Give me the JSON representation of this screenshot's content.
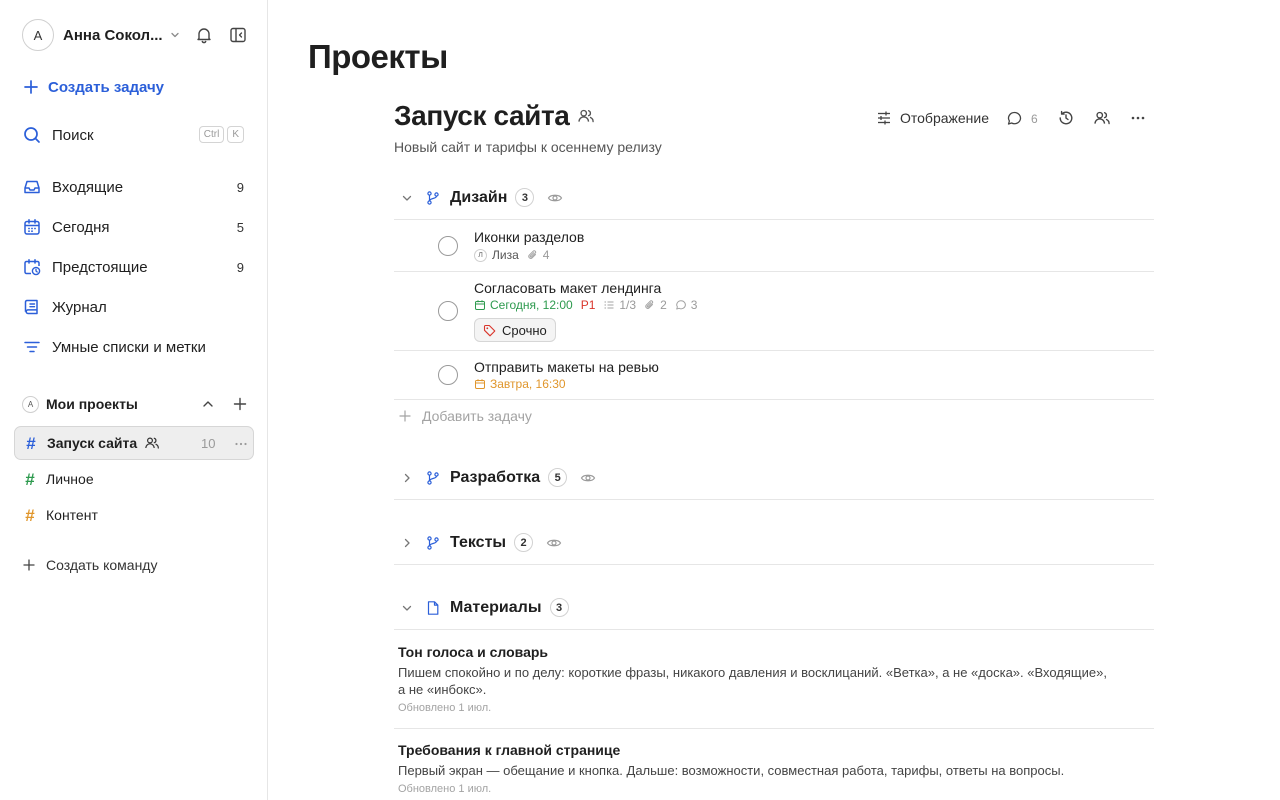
{
  "sidebar": {
    "user": {
      "initial": "А",
      "name": "Анна Сокол..."
    },
    "create_task": "Создать задачу",
    "search": {
      "label": "Поиск",
      "shortcut": [
        "Ctrl",
        "K"
      ]
    },
    "nav": [
      {
        "label": "Входящие",
        "count": "9",
        "icon": "inbox-icon"
      },
      {
        "label": "Сегодня",
        "count": "5",
        "icon": "calendar-icon"
      },
      {
        "label": "Предстоящие",
        "count": "9",
        "icon": "upcoming-icon"
      },
      {
        "label": "Журнал",
        "count": "",
        "icon": "journal-icon"
      },
      {
        "label": "Умные списки и метки",
        "count": "",
        "icon": "filter-icon"
      }
    ],
    "projects_section": {
      "initial": "А",
      "title": "Мои проекты"
    },
    "projects": [
      {
        "name": "Запуск сайта",
        "count": "10",
        "color": "#2b5fd9",
        "active": true
      },
      {
        "name": "Личное",
        "color": "#2d9a4e"
      },
      {
        "name": "Контент",
        "color": "#e0962c"
      }
    ],
    "create_team": "Создать команду"
  },
  "main": {
    "page_title": "Проекты",
    "project": {
      "title": "Запуск сайта",
      "description": "Новый сайт и тарифы к осеннему релизу"
    },
    "toolbar": {
      "display_label": "Отображение",
      "comments_count": "6"
    },
    "sections": [
      {
        "title": "Дизайн",
        "count": "3",
        "tasks": [
          {
            "title": "Иконки разделов",
            "assignee_initial": "Л",
            "assignee": "Лиза",
            "attachments": "4"
          },
          {
            "title": "Согласовать макет лендинга",
            "date": "Сегодня, 12:00",
            "priority": "P1",
            "subtasks": "1/3",
            "attachments": "2",
            "comments": "3",
            "tag": "Срочно"
          },
          {
            "title": "Отправить макеты на ревью",
            "date": "Завтра, 16:30"
          }
        ],
        "add_task": "Добавить задачу"
      },
      {
        "title": "Разработка",
        "count": "5"
      },
      {
        "title": "Тексты",
        "count": "2"
      },
      {
        "title": "Материалы",
        "count": "3",
        "docs": [
          {
            "title": "Тон голоса и словарь",
            "body": "Пишем спокойно и по делу: короткие фразы, никакого давления и восклицаний. «Ветка», а не «доска». «Входящие», а не «инбокс».",
            "updated": "Обновлено 1 июл."
          },
          {
            "title": "Требования к главной странице",
            "body": "Первый экран — обещание и кнопка. Дальше: возможности, совместная работа, тарифы, ответы на вопросы.",
            "updated": "Обновлено 1 июл."
          }
        ]
      }
    ]
  },
  "colors": {
    "accent": "#2b5fd9",
    "today": "#2d9a4e",
    "tomorrow": "#e0962c",
    "priority": "#d9352b"
  }
}
